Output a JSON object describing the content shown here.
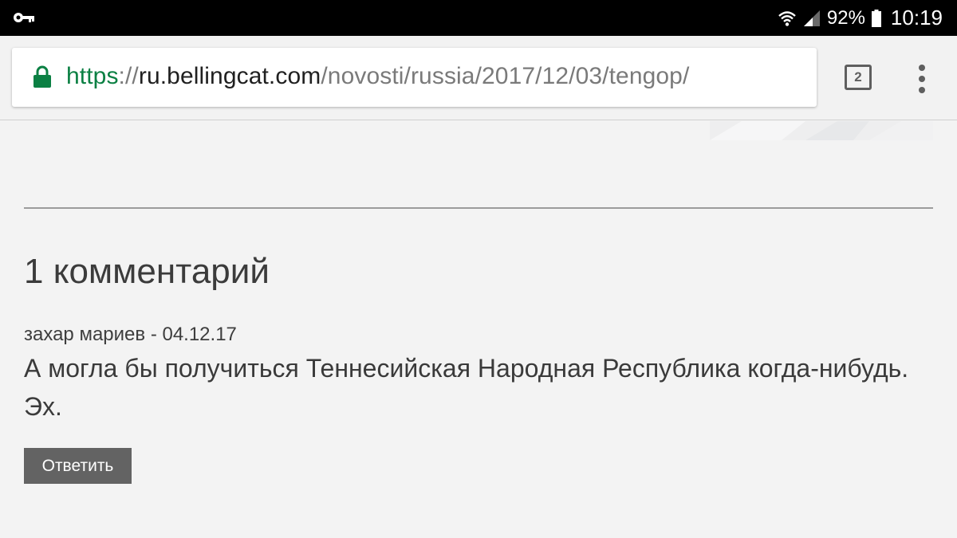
{
  "status_bar": {
    "battery": "92%",
    "time": "10:19",
    "icons": [
      "key-icon",
      "wifi-icon",
      "signal-icon",
      "battery-icon"
    ]
  },
  "browser": {
    "url": {
      "scheme": "https",
      "separator": "://",
      "host": "ru.bellingcat.com",
      "path": "/novosti/russia/2017/12/03/tengop/"
    },
    "tab_count": "2",
    "colors": {
      "secure": "#0b8043",
      "status_bar": "#000000"
    }
  },
  "comments": {
    "title": "1 комментарий",
    "items": [
      {
        "meta": "захар мариев - 04.12.17",
        "text": "А могла бы получиться Теннесийская Народная Республика когда-нибудь. Эх.",
        "reply_label": "Ответить"
      }
    ]
  }
}
